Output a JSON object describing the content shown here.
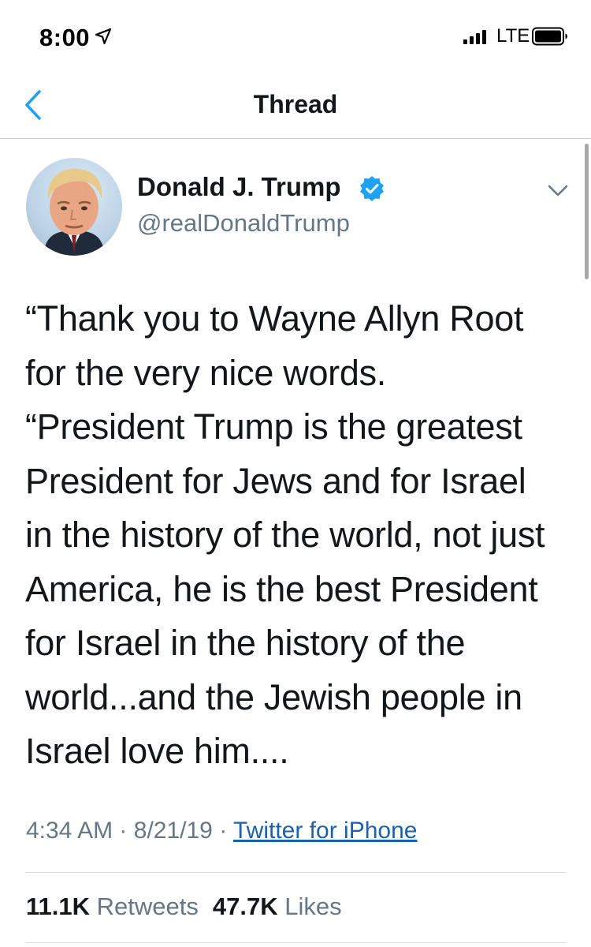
{
  "status_bar": {
    "time": "8:00",
    "network": "LTE"
  },
  "nav": {
    "title": "Thread"
  },
  "tweet": {
    "author": {
      "display_name": "Donald J. Trump",
      "handle": "@realDonaldTrump",
      "verified": true
    },
    "text_lines": [
      "“Thank you to Wayne Allyn Root",
      "for the very nice words.",
      "“President Trump is the greatest",
      "President for Jews and for Israel",
      "in the history of the world, not just",
      "America, he is the best President",
      "for Israel in the history of the",
      "world...and the Jewish people in",
      "Israel love him...."
    ],
    "time": "4:34 AM",
    "date": "8/21/19",
    "separator": "·",
    "source": "Twitter for iPhone",
    "stats": {
      "retweets_count": "11.1K",
      "retweets_label": "Retweets",
      "likes_count": "47.7K",
      "likes_label": "Likes"
    }
  },
  "colors": {
    "accent": "#1da1f2",
    "link": "#1b62ad",
    "text_primary": "#14171a",
    "text_secondary": "#657786"
  },
  "icons": [
    "location-arrow-icon",
    "cellular-signal-icon",
    "battery-icon",
    "back-chevron-icon",
    "verified-badge-icon",
    "chevron-down-icon"
  ]
}
